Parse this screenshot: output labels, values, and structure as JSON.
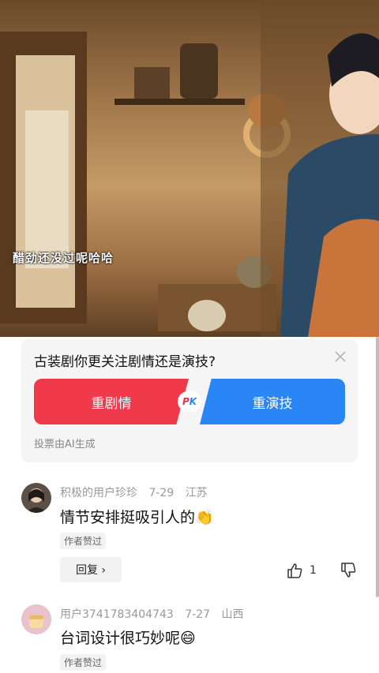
{
  "video": {
    "subtitle": "醋劲还没过呢哈哈"
  },
  "poll": {
    "question": "古装剧你更关注剧情还是演技?",
    "option_a": "重剧情",
    "option_b": "重演技",
    "vs_p": "P",
    "vs_k": "K",
    "note": "投票由AI生成",
    "colors": {
      "option_a": "#f0394a",
      "option_b": "#2a86f5"
    }
  },
  "comments": [
    {
      "username": "积极的用户珍珍",
      "date": "7-29",
      "location": "江苏",
      "text": "情节安排挺吸引人的👏",
      "badge": "作者赞过",
      "reply_label": "回复 ›",
      "likes": "1"
    },
    {
      "username": "用户3741783404743",
      "date": "7-27",
      "location": "山西",
      "text": "台词设计很巧妙呢😄",
      "badge": "作者赞过"
    }
  ]
}
